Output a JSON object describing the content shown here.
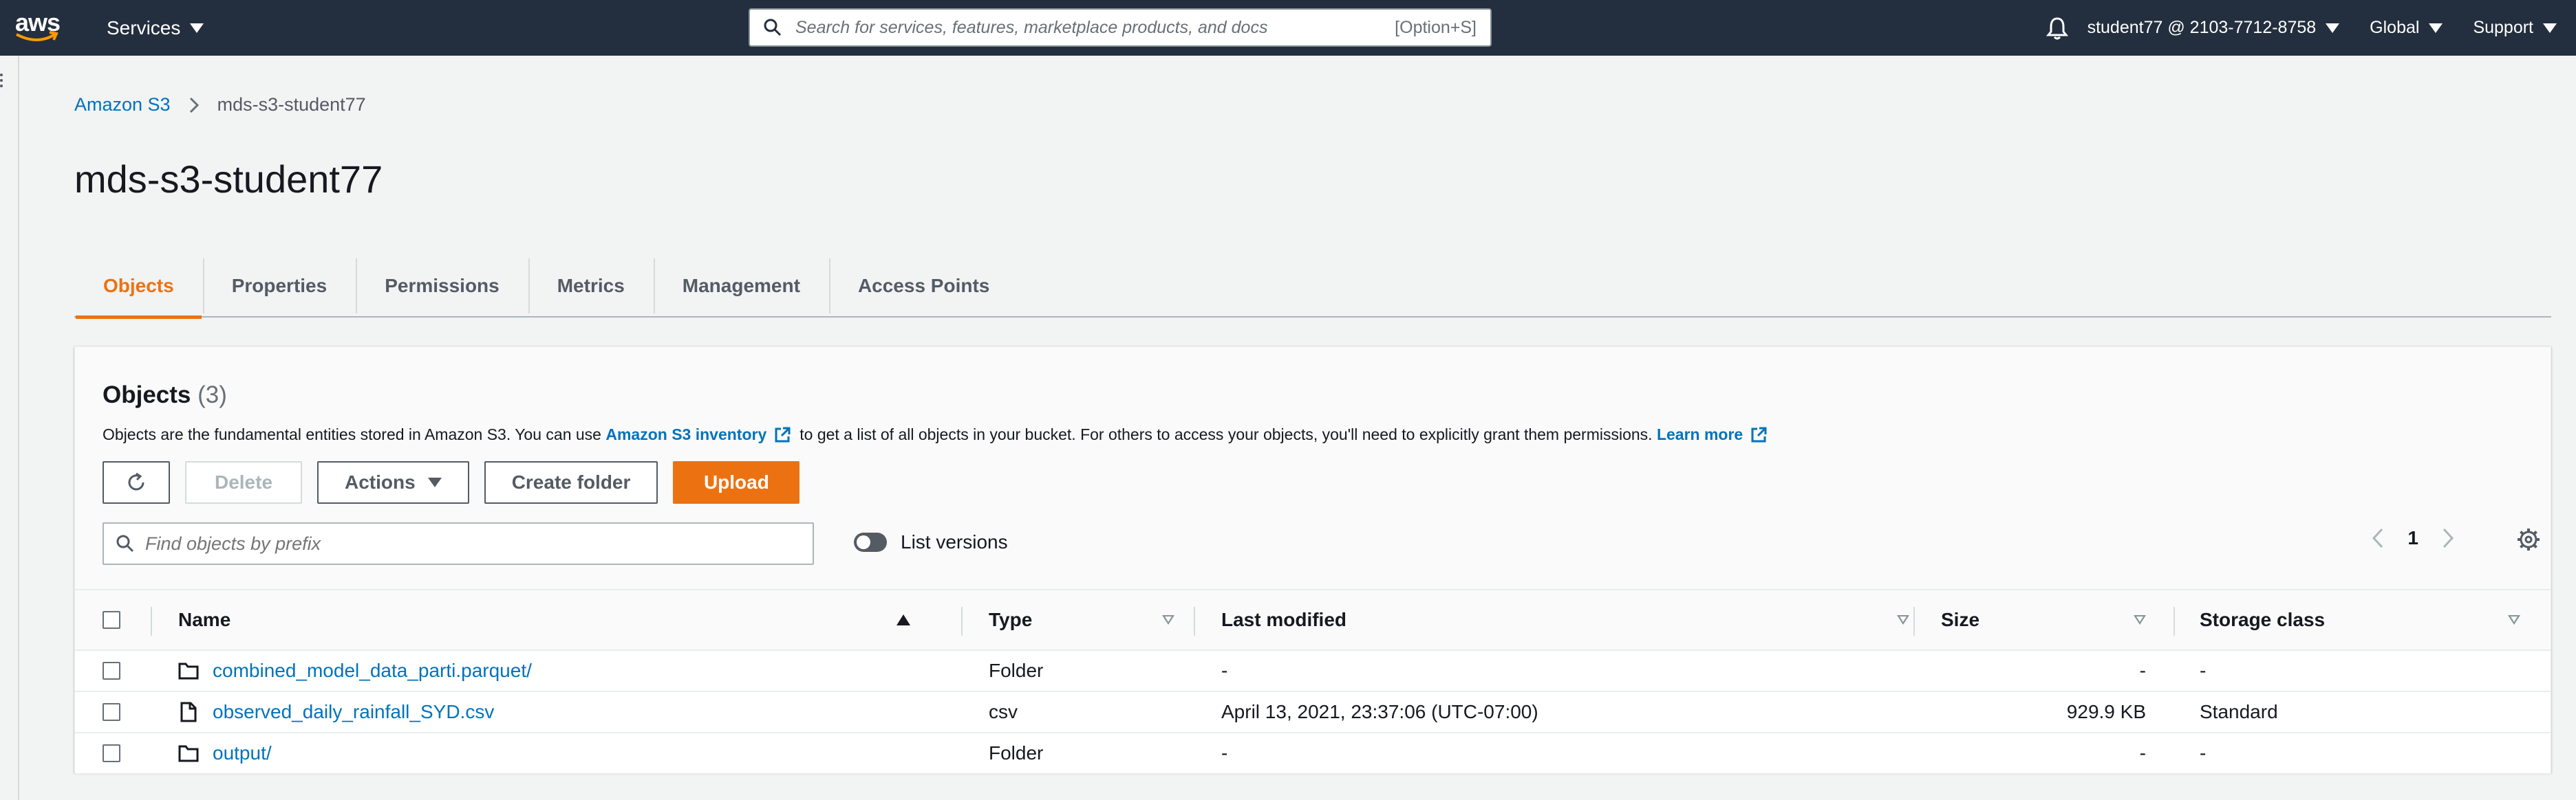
{
  "topnav": {
    "logo_text": "aws",
    "services_label": "Services",
    "search_placeholder": "Search for services, features, marketplace products, and docs",
    "search_shortcut": "[Option+S]",
    "account_label": "student77 @ 2103-7712-8758",
    "region_label": "Global",
    "support_label": "Support"
  },
  "breadcrumb": {
    "root": "Amazon S3",
    "current": "mds-s3-student77"
  },
  "page_title": "mds-s3-student77",
  "tabs": [
    {
      "label": "Objects"
    },
    {
      "label": "Properties"
    },
    {
      "label": "Permissions"
    },
    {
      "label": "Metrics"
    },
    {
      "label": "Management"
    },
    {
      "label": "Access Points"
    }
  ],
  "objects_panel": {
    "title": "Objects",
    "count": "(3)",
    "desc_part1": "Objects are the fundamental entities stored in Amazon S3. You can use",
    "desc_link1": "Amazon S3 inventory",
    "desc_part2": "to get a list of all objects in your bucket. For others to access your objects, you'll need to explicitly grant them permissions.",
    "desc_link2": "Learn more",
    "buttons": {
      "delete": "Delete",
      "actions": "Actions",
      "create_folder": "Create folder",
      "upload": "Upload"
    },
    "filter_placeholder": "Find objects by prefix",
    "list_versions_label": "List versions",
    "page_number": "1"
  },
  "table": {
    "columns": {
      "name": "Name",
      "type": "Type",
      "last_modified": "Last modified",
      "size": "Size",
      "storage_class": "Storage class"
    },
    "rows": [
      {
        "name": "combined_model_data_parti.parquet/",
        "kind": "folder",
        "type": "Folder",
        "last_modified": "-",
        "size": "-",
        "storage_class": "-"
      },
      {
        "name": "observed_daily_rainfall_SYD.csv",
        "kind": "file",
        "type": "csv",
        "last_modified": "April 13, 2021, 23:37:06 (UTC-07:00)",
        "size": "929.9 KB",
        "storage_class": "Standard"
      },
      {
        "name": "output/",
        "kind": "folder",
        "type": "Folder",
        "last_modified": "-",
        "size": "-",
        "storage_class": "-"
      }
    ]
  },
  "colors": {
    "nav_bg": "#232f3e",
    "accent": "#ec7211",
    "link": "#0073bb"
  }
}
